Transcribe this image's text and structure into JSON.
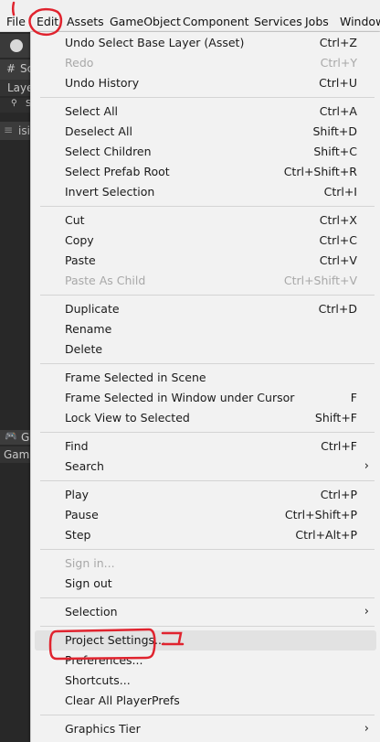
{
  "menubar": {
    "items": [
      "File",
      "Edit",
      "Assets",
      "GameObject",
      "Component",
      "Services",
      "Jobs",
      "Window"
    ]
  },
  "editor": {
    "scene_tab": "Sc",
    "layers": "Laye",
    "search_text": "S",
    "hier_item": "isi",
    "game_tab": "G",
    "game_label": "Game"
  },
  "menu": {
    "groups": [
      [
        {
          "label": "Undo Select Base Layer (Asset)",
          "shortcut": "Ctrl+Z"
        },
        {
          "label": "Redo",
          "shortcut": "Ctrl+Y",
          "disabled": true
        },
        {
          "label": "Undo History",
          "shortcut": "Ctrl+U"
        }
      ],
      [
        {
          "label": "Select All",
          "shortcut": "Ctrl+A"
        },
        {
          "label": "Deselect All",
          "shortcut": "Shift+D"
        },
        {
          "label": "Select Children",
          "shortcut": "Shift+C"
        },
        {
          "label": "Select Prefab Root",
          "shortcut": "Ctrl+Shift+R"
        },
        {
          "label": "Invert Selection",
          "shortcut": "Ctrl+I"
        }
      ],
      [
        {
          "label": "Cut",
          "shortcut": "Ctrl+X"
        },
        {
          "label": "Copy",
          "shortcut": "Ctrl+C"
        },
        {
          "label": "Paste",
          "shortcut": "Ctrl+V"
        },
        {
          "label": "Paste As Child",
          "shortcut": "Ctrl+Shift+V",
          "disabled": true
        }
      ],
      [
        {
          "label": "Duplicate",
          "shortcut": "Ctrl+D"
        },
        {
          "label": "Rename",
          "shortcut": ""
        },
        {
          "label": "Delete",
          "shortcut": ""
        }
      ],
      [
        {
          "label": "Frame Selected in Scene",
          "shortcut": ""
        },
        {
          "label": "Frame Selected in Window under Cursor",
          "shortcut": "F"
        },
        {
          "label": "Lock View to Selected",
          "shortcut": "Shift+F"
        }
      ],
      [
        {
          "label": "Find",
          "shortcut": "Ctrl+F"
        },
        {
          "label": "Search",
          "shortcut": "",
          "submenu": true
        }
      ],
      [
        {
          "label": "Play",
          "shortcut": "Ctrl+P"
        },
        {
          "label": "Pause",
          "shortcut": "Ctrl+Shift+P"
        },
        {
          "label": "Step",
          "shortcut": "Ctrl+Alt+P"
        }
      ],
      [
        {
          "label": "Sign in...",
          "shortcut": "",
          "disabled": true
        },
        {
          "label": "Sign out",
          "shortcut": ""
        }
      ],
      [
        {
          "label": "Selection",
          "shortcut": "",
          "submenu": true
        }
      ],
      [
        {
          "label": "Project Settings...",
          "shortcut": "",
          "highlighted": true
        },
        {
          "label": "Preferences...",
          "shortcut": ""
        },
        {
          "label": "Shortcuts...",
          "shortcut": ""
        },
        {
          "label": "Clear All PlayerPrefs",
          "shortcut": ""
        }
      ],
      [
        {
          "label": "Graphics Tier",
          "shortcut": "",
          "submenu": true
        }
      ]
    ]
  },
  "annotations": {
    "step1": "1",
    "step2": "2",
    "ink_color": "#e0232e"
  },
  "colors": {
    "menu_bg": "#f2f2f2",
    "menubar_bg": "#f0f0f0",
    "editor_bg": "#282828",
    "disabled_text": "#a8a8a8"
  }
}
